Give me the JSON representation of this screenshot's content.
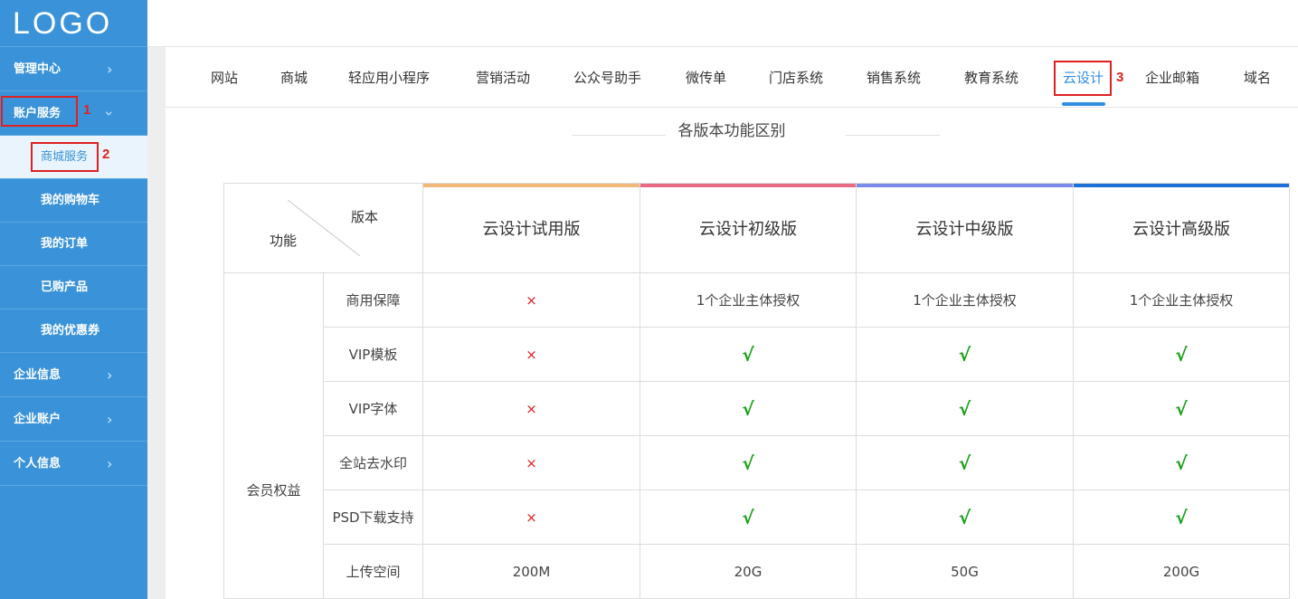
{
  "logo": "LOGO",
  "sidebar": {
    "items": [
      {
        "label": "管理中心"
      },
      {
        "label": "账户服务"
      },
      {
        "label": "企业信息"
      },
      {
        "label": "企业账户"
      },
      {
        "label": "个人信息"
      }
    ],
    "sub_items": [
      {
        "label": "商城服务"
      },
      {
        "label": "我的购物车"
      },
      {
        "label": "我的订单"
      },
      {
        "label": "已购产品"
      },
      {
        "label": "我的优惠券"
      }
    ],
    "chevron": "›"
  },
  "annotations": [
    "1",
    "2",
    "3"
  ],
  "tabs": [
    "网站",
    "商城",
    "轻应用小程序",
    "营销活动",
    "公众号助手",
    "微传单",
    "门店系统",
    "销售系统",
    "教育系统",
    "云设计",
    "企业邮箱",
    "域名"
  ],
  "active_tab": "云设计",
  "section_title": "各版本功能区别",
  "table": {
    "corner_version": "版本",
    "corner_function": "功能",
    "versions": [
      "云设计试用版",
      "云设计初级版",
      "云设计中级版",
      "云设计高级版"
    ],
    "version_colors": [
      "#f0b97a",
      "#e86a86",
      "#7c8ae8",
      "#1e6fd6"
    ],
    "group": "会员权益",
    "rows": [
      {
        "feature": "商用保障",
        "values": [
          "×",
          "1个企业主体授权",
          "1个企业主体授权",
          "1个企业主体授权"
        ]
      },
      {
        "feature": "VIP模板",
        "values": [
          "×",
          "√",
          "√",
          "√"
        ]
      },
      {
        "feature": "VIP字体",
        "values": [
          "×",
          "√",
          "√",
          "√"
        ]
      },
      {
        "feature": "全站去水印",
        "values": [
          "×",
          "√",
          "√",
          "√"
        ]
      },
      {
        "feature": "PSD下载支持",
        "values": [
          "×",
          "√",
          "√",
          "√"
        ]
      },
      {
        "feature": "上传空间",
        "values": [
          "200M",
          "20G",
          "50G",
          "200G"
        ]
      }
    ]
  }
}
